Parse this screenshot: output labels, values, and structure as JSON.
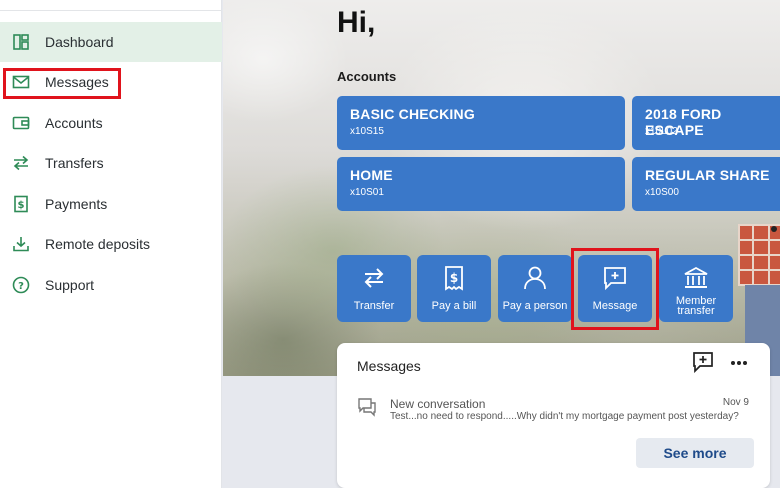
{
  "sidebar": {
    "items": [
      {
        "label": "Dashboard",
        "icon": "dashboard-icon",
        "active": true
      },
      {
        "label": "Messages",
        "icon": "mail-icon"
      },
      {
        "label": "Accounts",
        "icon": "wallet-icon"
      },
      {
        "label": "Transfers",
        "icon": "transfer-arrows-icon"
      },
      {
        "label": "Payments",
        "icon": "dollar-receipt-icon"
      },
      {
        "label": "Remote deposits",
        "icon": "download-icon"
      },
      {
        "label": "Support",
        "icon": "help-circle-icon"
      }
    ]
  },
  "main": {
    "greeting": "Hi,",
    "accounts_heading": "Accounts",
    "accounts": [
      {
        "name": "BASIC CHECKING",
        "number": "x10S15"
      },
      {
        "name": "2018 FORD ESCAPE",
        "number": "x10L02"
      },
      {
        "name": "HOME",
        "number": "x10S01"
      },
      {
        "name": "REGULAR SHARE",
        "number": "x10S00"
      }
    ],
    "actions": [
      {
        "label": "Transfer",
        "icon": "transfer-icon"
      },
      {
        "label": "Pay a bill",
        "icon": "bill-icon"
      },
      {
        "label": "Pay a person",
        "icon": "person-icon"
      },
      {
        "label": "Message",
        "icon": "message-icon"
      },
      {
        "label_line1": "Member",
        "label_line2": "transfer",
        "icon": "bank-icon"
      }
    ]
  },
  "messages_card": {
    "title": "Messages",
    "item": {
      "subject": "New conversation",
      "date": "Nov 9",
      "preview": "Test...no need to respond.....Why didn't my mortgage payment post yesterday?"
    },
    "see_more_label": "See more"
  },
  "colors": {
    "accent_blue": "#3a78c9",
    "nav_active_bg": "#e3f0e7",
    "nav_icon_green": "#2e8b57",
    "highlight_red": "#e0131c"
  }
}
